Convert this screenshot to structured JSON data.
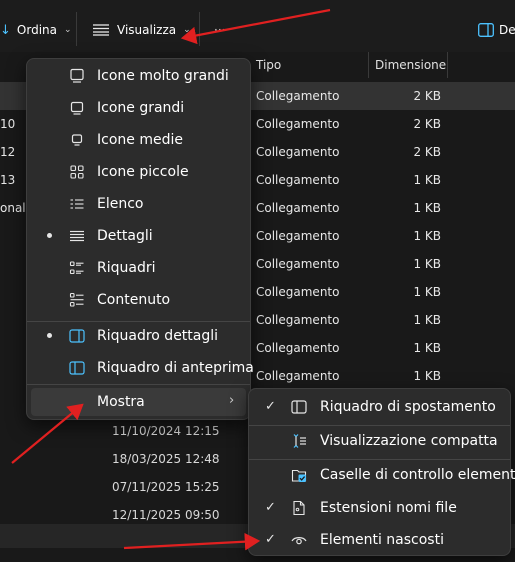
{
  "toolbar": {
    "sort_label": "Ordina",
    "view_label": "Visualizza",
    "more_label": "···",
    "details_label": "De"
  },
  "columns": {
    "type": "Tipo",
    "size": "Dimensione"
  },
  "files": [
    {
      "frag": "",
      "type": "Collegamento",
      "size": "2 KB"
    },
    {
      "frag": "10",
      "type": "Collegamento",
      "size": "2 KB"
    },
    {
      "frag": "12",
      "type": "Collegamento",
      "size": "2 KB"
    },
    {
      "frag": "13",
      "type": "Collegamento",
      "size": "1 KB"
    },
    {
      "frag": "onal",
      "type": "Collegamento",
      "size": "1 KB"
    },
    {
      "frag": "",
      "type": "Collegamento",
      "size": "1 KB"
    },
    {
      "frag": "",
      "type": "Collegamento",
      "size": "1 KB"
    },
    {
      "frag": "",
      "type": "Collegamento",
      "size": "1 KB"
    },
    {
      "frag": "",
      "type": "Collegamento",
      "size": "1 KB"
    },
    {
      "frag": "",
      "type": "Collegamento",
      "size": "1 KB"
    },
    {
      "frag": "",
      "type": "Collegamento",
      "size": "1 KB"
    }
  ],
  "dates": [
    "11/10/2024 12:15",
    "18/03/2025 12:48",
    "07/11/2025 15:25",
    "12/11/2025 09:50"
  ],
  "view_menu": {
    "items": [
      {
        "label": "Icone molto grandi",
        "icon": "monitor-large-icon",
        "selected": false
      },
      {
        "label": "Icone grandi",
        "icon": "monitor-icon",
        "selected": false
      },
      {
        "label": "Icone medie",
        "icon": "monitor-small-icon",
        "selected": false
      },
      {
        "label": "Icone piccole",
        "icon": "small-icons-grid-icon",
        "selected": false
      },
      {
        "label": "Elenco",
        "icon": "list-icon",
        "selected": false
      },
      {
        "label": "Dettagli",
        "icon": "details-icon",
        "selected": true
      },
      {
        "label": "Riquadri",
        "icon": "tiles-icon",
        "selected": false
      },
      {
        "label": "Contenuto",
        "icon": "content-icon",
        "selected": false
      },
      {
        "label": "Riquadro dettagli",
        "icon": "details-pane-icon",
        "selected": true
      },
      {
        "label": "Riquadro di anteprima",
        "icon": "preview-pane-icon",
        "selected": false
      },
      {
        "label": "Mostra",
        "icon": "",
        "selected": false
      }
    ]
  },
  "show_menu": {
    "items": [
      {
        "label": "Riquadro di spostamento",
        "icon": "navigation-pane-icon",
        "checked": true
      },
      {
        "label": "Visualizzazione compatta",
        "icon": "compact-view-icon",
        "checked": false
      },
      {
        "label": "Caselle di controllo elementi",
        "icon": "item-checkbox-icon",
        "checked": false
      },
      {
        "label": "Estensioni nomi file",
        "icon": "file-extension-icon",
        "checked": true
      },
      {
        "label": "Elementi nascosti",
        "icon": "eye-icon",
        "checked": true
      }
    ]
  },
  "colors": {
    "annotation_arrow": "#e02020",
    "checkbox_accent": "#4cc2ff"
  }
}
